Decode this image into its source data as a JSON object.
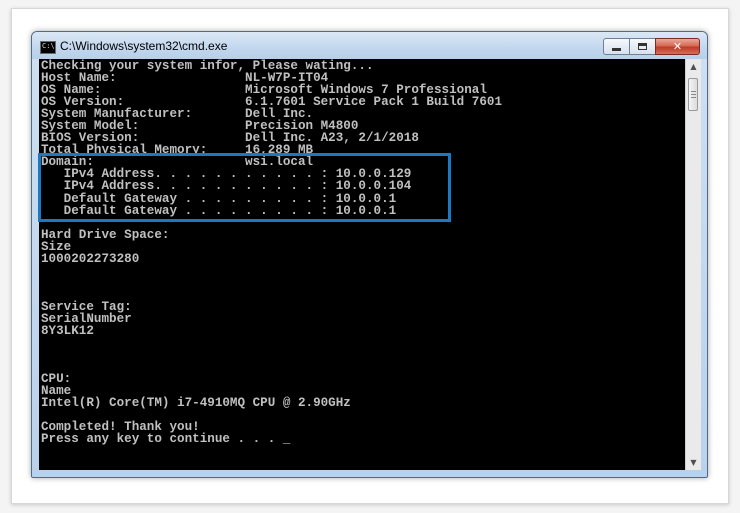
{
  "window": {
    "title": "C:\\Windows\\system32\\cmd.exe",
    "icon_label": "C:\\",
    "buttons": {
      "minimize": "minimize-icon",
      "maximize": "maximize-icon",
      "close_label": "✕"
    }
  },
  "console": {
    "lines": [
      "Checking your system infor, Please wating...",
      "Host Name:                 NL-W7P-IT04",
      "OS Name:                   Microsoft Windows 7 Professional",
      "OS Version:                6.1.7601 Service Pack 1 Build 7601",
      "System Manufacturer:       Dell Inc.",
      "System Model:              Precision M4800",
      "BIOS Version:              Dell Inc. A23, 2/1/2018",
      "Total Physical Memory:     16,289 MB",
      "Domain:                    wsi.local",
      "   IPv4 Address. . . . . . . . . . . : 10.0.0.129",
      "   IPv4 Address. . . . . . . . . . . : 10.0.0.104",
      "   Default Gateway . . . . . . . . . : 10.0.0.1",
      "   Default Gateway . . . . . . . . . : 10.0.0.1",
      "",
      "Hard Drive Space:",
      "Size",
      "1000202273280",
      "",
      "",
      "",
      "Service Tag:",
      "SerialNumber",
      "8Y3LK12",
      "",
      "",
      "",
      "CPU:",
      "Name",
      "Intel(R) Core(TM) i7-4910MQ CPU @ 2.90GHz",
      "",
      "Completed! Thank you!",
      "Press any key to continue . . . _"
    ]
  },
  "highlight": {
    "color": "#1a79c4"
  },
  "scrollbar": {
    "up": "▲",
    "down": "▼"
  }
}
